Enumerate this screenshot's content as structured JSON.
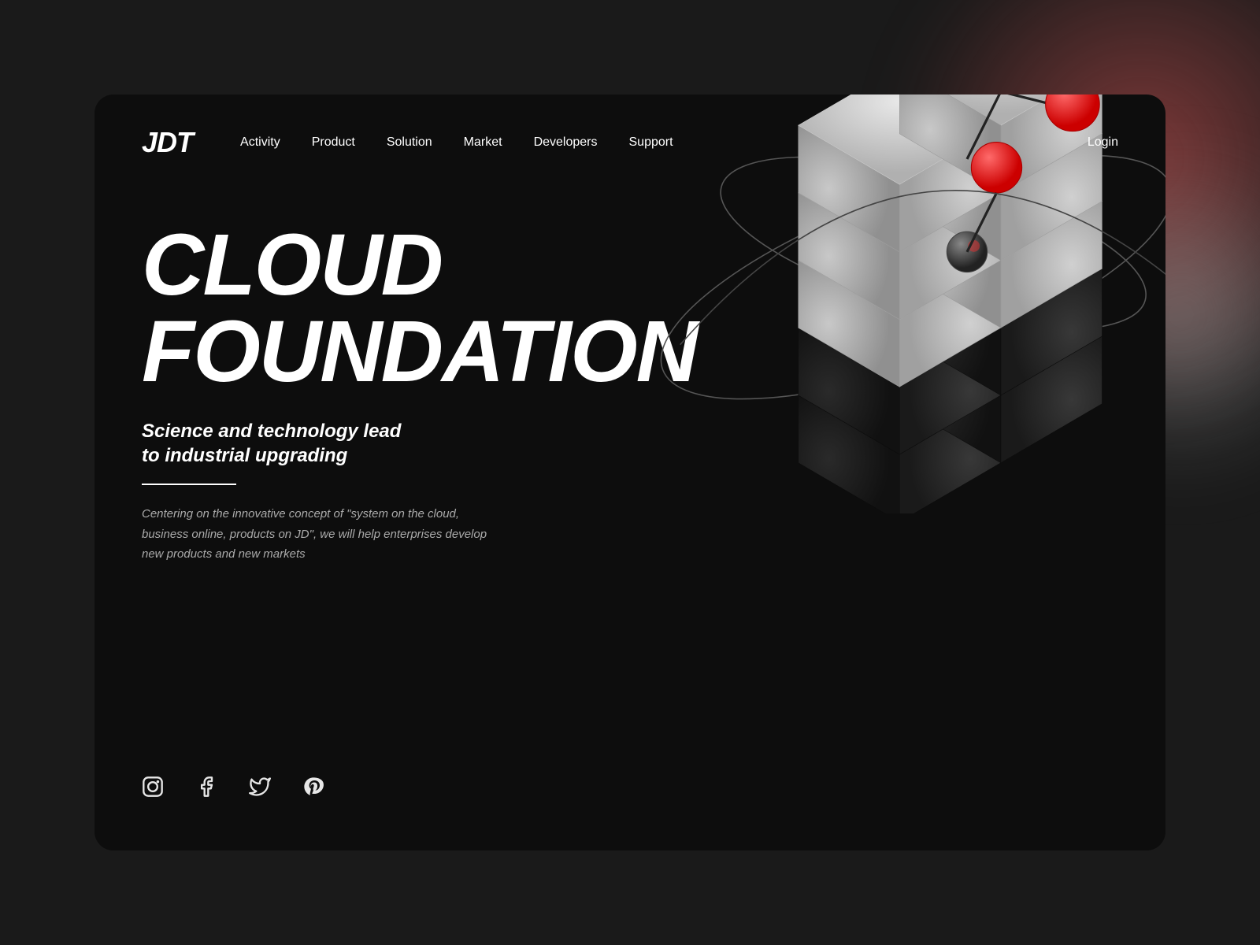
{
  "logo": "JDT",
  "nav": {
    "links": [
      {
        "label": "Activity",
        "id": "activity"
      },
      {
        "label": "Product",
        "id": "product"
      },
      {
        "label": "Solution",
        "id": "solution"
      },
      {
        "label": "Market",
        "id": "market"
      },
      {
        "label": "Developers",
        "id": "developers"
      },
      {
        "label": "Support",
        "id": "support"
      }
    ],
    "login": "Login"
  },
  "hero": {
    "title_line1": "CLOUD",
    "title_line2": "FOUNDATION",
    "subtitle": "Science and technology lead\nto industrial upgrading",
    "description": "Centering on the innovative concept of \"system on the cloud, business online, products on JD\", we will help enterprises develop new products and new markets"
  },
  "social": [
    {
      "label": "Instagram",
      "id": "instagram"
    },
    {
      "label": "Facebook",
      "id": "facebook"
    },
    {
      "label": "Twitter",
      "id": "twitter"
    },
    {
      "label": "Pinterest",
      "id": "pinterest"
    }
  ],
  "colors": {
    "background": "#0d0d0d",
    "text_primary": "#ffffff",
    "text_secondary": "#aaaaaa",
    "accent_red": "#e63946",
    "cube_light": "#d0d0d0",
    "cube_dark": "#1a1a1a"
  }
}
